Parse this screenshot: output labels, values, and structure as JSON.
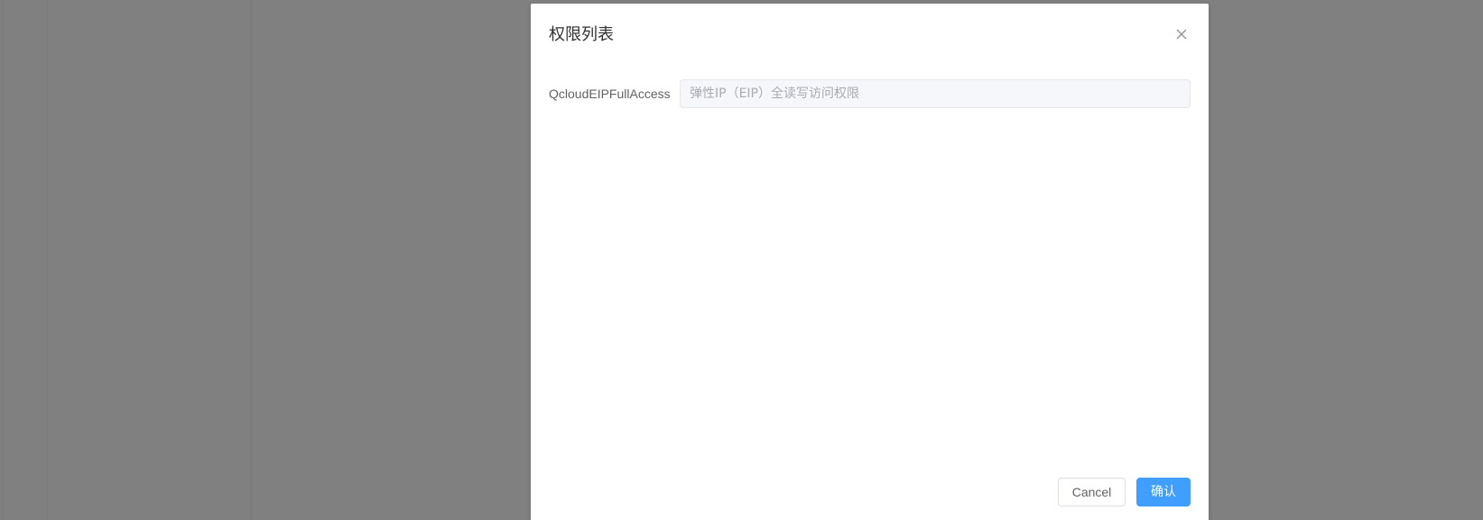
{
  "dialog": {
    "title": "权限列表",
    "close_icon": "close-icon"
  },
  "form": {
    "policy_label": "QcloudEIPFullAccess",
    "policy_description_placeholder": "弹性IP（EIP）全读写访问权限",
    "policy_description_value": ""
  },
  "footer": {
    "cancel_label": "Cancel",
    "confirm_label": "确认"
  },
  "colors": {
    "overlay": "#808080",
    "primary": "#409eff",
    "disabled_input_bg": "#f5f7fa"
  }
}
